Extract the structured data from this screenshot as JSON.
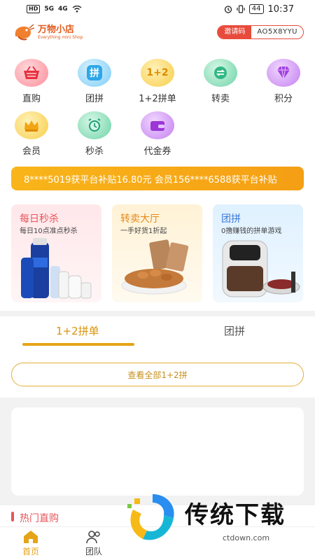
{
  "status_bar": {
    "left_indicators": [
      "HD",
      "5G",
      "4G"
    ],
    "battery": "44",
    "time": "10:37"
  },
  "header": {
    "logo_title": "万物小店",
    "logo_subtitle": "Everything mini Shop",
    "invite_label": "邀请码",
    "invite_code": "AO5X8YYU"
  },
  "grid": {
    "items": [
      {
        "label": "直购",
        "glyph": "",
        "icon": "shopping-basket-icon"
      },
      {
        "label": "团拼",
        "glyph": "拼",
        "icon": "group-buy-icon"
      },
      {
        "label": "1+2拼单",
        "glyph": "1+2",
        "icon": "one-plus-two-icon"
      },
      {
        "label": "转卖",
        "glyph": "",
        "icon": "resell-exchange-icon"
      },
      {
        "label": "积分",
        "glyph": "",
        "icon": "diamond-icon"
      },
      {
        "label": "会员",
        "glyph": "",
        "icon": "crown-icon"
      },
      {
        "label": "秒杀",
        "glyph": "",
        "icon": "alarm-clock-icon"
      },
      {
        "label": "代金券",
        "glyph": "",
        "icon": "wallet-icon"
      }
    ]
  },
  "marquee": {
    "text": "8****5019获平台补贴16.80元    会员156****6588获平台补贴"
  },
  "promos": [
    {
      "title": "每日秒杀",
      "subtitle": "每日10点准点秒杀"
    },
    {
      "title": "转卖大厅",
      "subtitle": "一手好货1折起"
    },
    {
      "title": "团拼",
      "subtitle": "0撸赚钱的拼单游戏"
    }
  ],
  "tabs": {
    "active": "1+2拼单",
    "inactive": "团拼"
  },
  "view_all": "查看全部1+2拼",
  "section": {
    "title": "热门直购"
  },
  "tabbar": {
    "home": "首页",
    "team": "团队"
  },
  "watermark": {
    "text": "传统下载",
    "url": "ctdown.com"
  },
  "colors": {
    "accent": "#e5a317",
    "brand": "#e25a1c",
    "invite": "#e84b3c"
  }
}
